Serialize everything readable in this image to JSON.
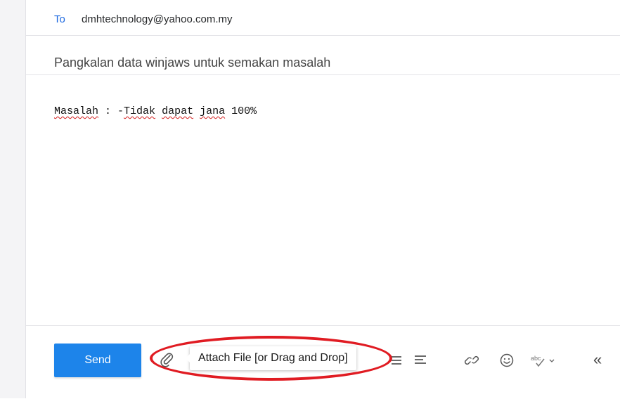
{
  "compose": {
    "to_label": "To",
    "to_value": "dmhtechnology@yahoo.com.my",
    "subject": "Pangkalan data winjaws untuk semakan masalah",
    "body": {
      "w1": "Masalah",
      "sep": " : -",
      "w2": "Tidak",
      "w3": "dapat",
      "w4": "jana",
      "tail": " 100%"
    }
  },
  "toolbar": {
    "send_label": "Send",
    "attach_tooltip": "Attach File [or Drag and Drop]",
    "icons": [
      "paperclip-icon",
      "align-icon",
      "align-left-icon",
      "link-icon",
      "emoji-icon",
      "spellcheck-icon",
      "collapse-icon"
    ],
    "collapse_glyph": "«"
  },
  "colors": {
    "accent": "#1d84ea",
    "to_label": "#1d69e0",
    "highlight": "#e01b22"
  }
}
